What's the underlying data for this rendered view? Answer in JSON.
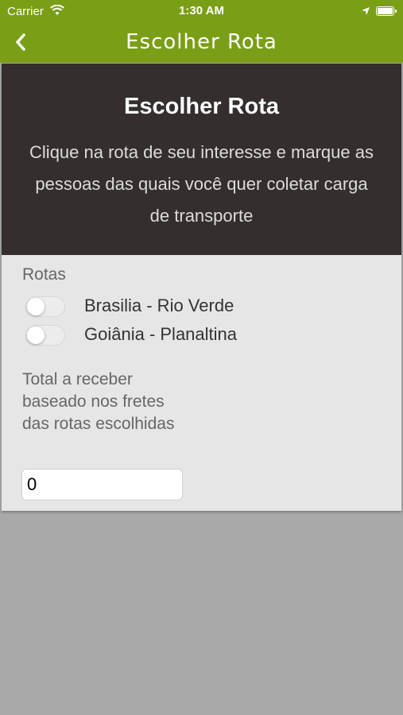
{
  "status_bar": {
    "carrier": "Carrier",
    "time": "1:30 AM",
    "icons": [
      "wifi-icon",
      "location-icon",
      "battery-icon"
    ]
  },
  "navbar": {
    "back_icon": "chevron-left-icon",
    "title": "Escolher Rota"
  },
  "banner": {
    "title": "Escolher Rota",
    "description": "Clique na rota de seu interesse e marque as pessoas das quais você quer coletar carga de transporte"
  },
  "routes": {
    "label": "Rotas",
    "items": [
      {
        "label": "Brasilia - Rio Verde",
        "enabled": false
      },
      {
        "label": "Goiânia - Planaltina",
        "enabled": false
      }
    ]
  },
  "total": {
    "label": "Total a receber baseado nos fretes das rotas escolhidas",
    "value": "0"
  },
  "colors": {
    "nav_green": "#7a9e16",
    "banner_dark": "#352e2e",
    "panel": "#e6e6e6",
    "background": "#a9a9a9"
  }
}
